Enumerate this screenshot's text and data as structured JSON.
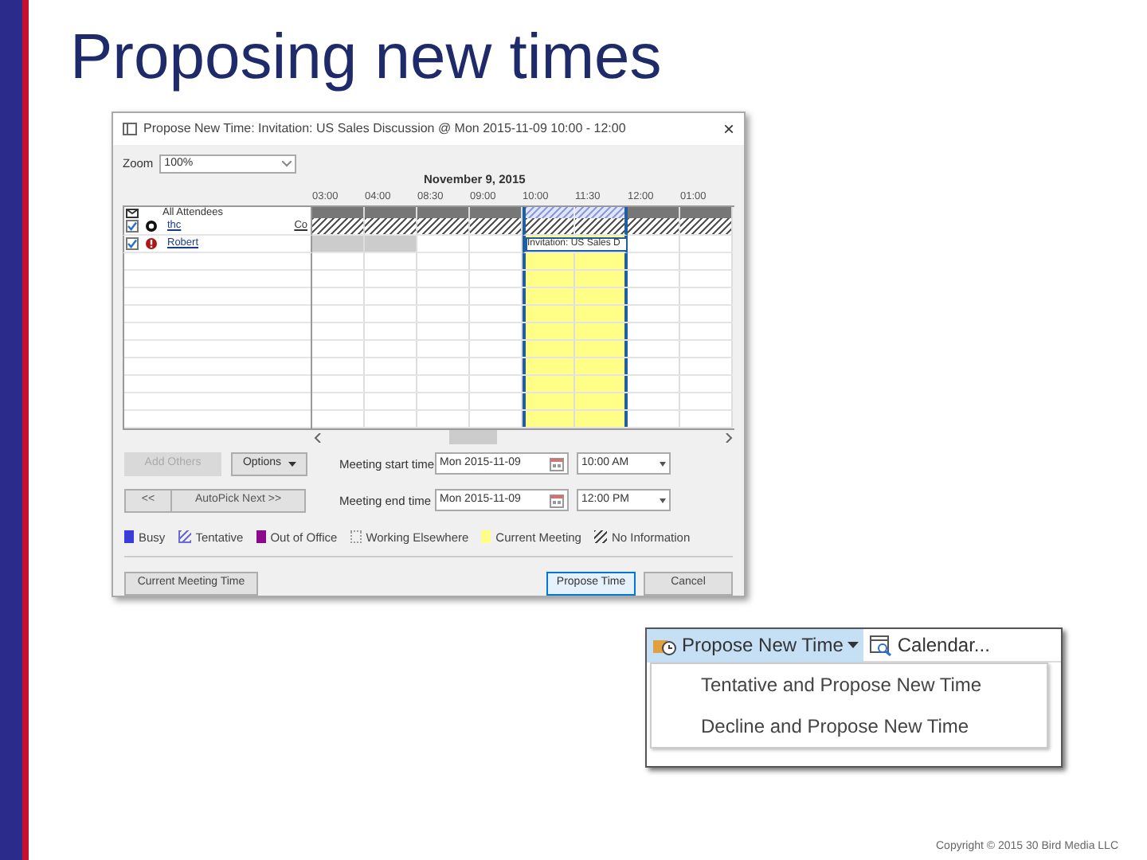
{
  "slide": {
    "title": "Proposing new times",
    "copyright": "Copyright © 2015 30 Bird Media LLC"
  },
  "dialog": {
    "title": "Propose New Time: Invitation: US Sales Discussion @ Mon 2015-11-09 10:00 - 12:00",
    "close": "×",
    "zoom_label": "Zoom",
    "zoom_value": "100%",
    "date_header": "November 9, 2015",
    "times": [
      {
        "label": "03:00",
        "selected": false
      },
      {
        "label": "04:00",
        "selected": false
      },
      {
        "label": "08:30",
        "selected": false
      },
      {
        "label": "09:00",
        "selected": false
      },
      {
        "label": "10:00",
        "selected": true
      },
      {
        "label": "11:30",
        "selected": true
      },
      {
        "label": "12:00",
        "selected": false
      },
      {
        "label": "01:00",
        "selected": false
      }
    ],
    "attendees_header": "All Attendees",
    "attendees": [
      {
        "name": "thc",
        "suffix": "Co",
        "checked": true,
        "kind": "organizer",
        "no_information": true
      },
      {
        "name": "Robert",
        "checked": true,
        "kind": "required",
        "no_information": false,
        "busy": [
          true,
          true,
          false,
          false,
          false,
          false,
          false,
          false
        ]
      }
    ],
    "meeting_label": "Invitation: US Sales D",
    "add_others": "Add Others",
    "options": "Options",
    "prev": "<<",
    "autopick": "AutoPick Next >>",
    "start_label": "Meeting start time",
    "start_date": "Mon 2015-11-09",
    "start_time": "10:00 AM",
    "end_label": "Meeting end time",
    "end_date": "Mon 2015-11-09",
    "end_time": "12:00 PM",
    "legend": [
      {
        "label": "Busy",
        "kind": "solid",
        "color": "#3b3bdb"
      },
      {
        "label": "Tentative",
        "kind": "striped",
        "color": "#6b6bdb"
      },
      {
        "label": "Out of Office",
        "kind": "solid",
        "color": "#8b0a8b"
      },
      {
        "label": "Working Elsewhere",
        "kind": "dotted",
        "color": "#9a9a9a"
      },
      {
        "label": "Current Meeting",
        "kind": "solid",
        "color": "#ffff88"
      },
      {
        "label": "No Information",
        "kind": "hatched",
        "color": "#444444"
      }
    ],
    "current_meeting_time": "Current Meeting Time",
    "propose": "Propose Time",
    "cancel": "Cancel"
  },
  "menu": {
    "split_button": "Propose New Time",
    "calendar_button": "Calendar...",
    "items": [
      {
        "label": "Tentative and Propose New Time"
      },
      {
        "label": "Decline and Propose New Time"
      }
    ]
  }
}
